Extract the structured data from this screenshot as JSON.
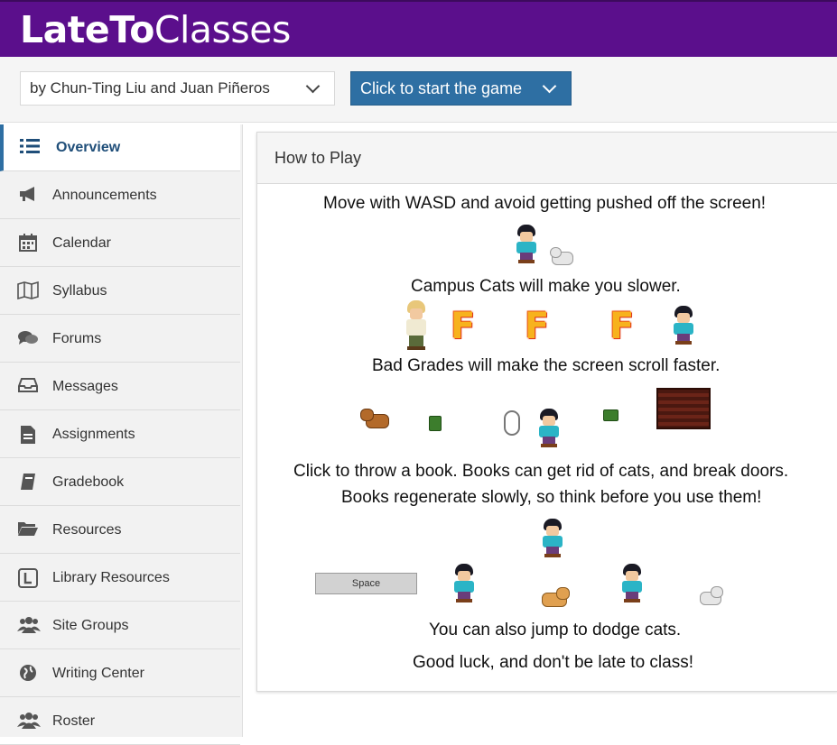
{
  "header": {
    "title_bold": "LateTo",
    "title_light": "Classes",
    "background": "#5b0f8c"
  },
  "toolbar": {
    "author_select": "by Chun-Ting Liu and Juan Piñeros",
    "start_button": "Click to start the game",
    "accent": "#2e6fa3"
  },
  "sidebar": {
    "items": [
      {
        "label": "Overview",
        "icon": "list-icon",
        "active": true
      },
      {
        "label": "Announcements",
        "icon": "megaphone-icon"
      },
      {
        "label": "Calendar",
        "icon": "calendar-icon"
      },
      {
        "label": "Syllabus",
        "icon": "map-icon"
      },
      {
        "label": "Forums",
        "icon": "comments-icon"
      },
      {
        "label": "Messages",
        "icon": "inbox-icon"
      },
      {
        "label": "Assignments",
        "icon": "document-icon"
      },
      {
        "label": "Gradebook",
        "icon": "book-icon"
      },
      {
        "label": "Resources",
        "icon": "folder-icon"
      },
      {
        "label": "Library Resources",
        "icon": "library-icon"
      },
      {
        "label": "Site Groups",
        "icon": "users-icon"
      },
      {
        "label": "Writing Center",
        "icon": "globe-icon"
      },
      {
        "label": "Roster",
        "icon": "users-icon"
      }
    ]
  },
  "card": {
    "title": "How to Play",
    "lines": [
      "Move with WASD and avoid getting pushed off the screen!",
      "Campus Cats will make you slower.",
      "Bad Grades will make the screen scroll faster.",
      "Click to throw a book. Books can get rid of cats, and break doors.",
      "Books regenerate slowly, so think before you use them!",
      "You can also jump to dodge cats.",
      "Good luck, and don't be late to class!"
    ],
    "grade_letter": "F",
    "space_key": "Space"
  }
}
